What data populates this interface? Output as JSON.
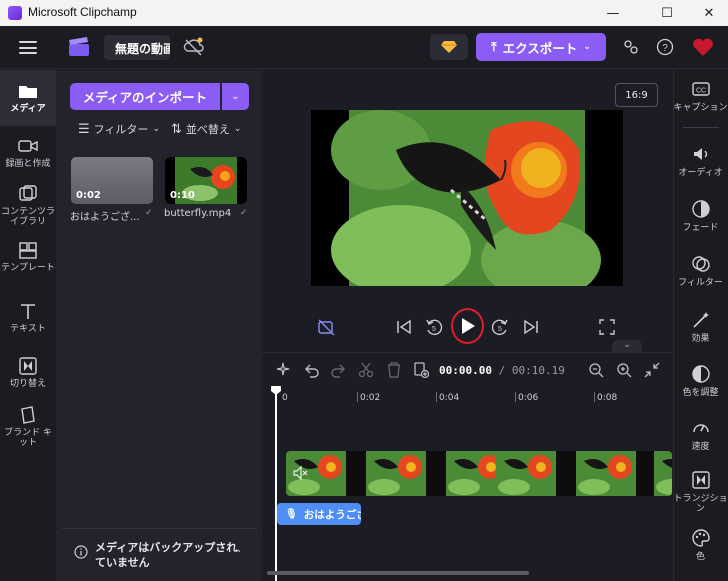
{
  "window": {
    "title": "Microsoft Clipchamp",
    "minimize": "—",
    "maximize": "☐",
    "close": "✕"
  },
  "header": {
    "project_title": "無題の動画",
    "export_label": "エクスポート"
  },
  "left_nav": [
    {
      "label": "メディア",
      "icon": "media-folder-icon"
    },
    {
      "label": "録画と作成",
      "icon": "camera-icon"
    },
    {
      "label": "コンテンツライブラリ",
      "icon": "library-icon"
    },
    {
      "label": "テンプレート",
      "icon": "template-icon"
    },
    {
      "label": "テキスト",
      "icon": "text-icon"
    },
    {
      "label": "切り替え",
      "icon": "transition-icon"
    },
    {
      "label": "ブランド キット",
      "icon": "brand-kit-icon"
    }
  ],
  "media": {
    "import_label": "メディアのインポート",
    "filter_label": "フィルター",
    "sort_label": "並べ替え",
    "items": [
      {
        "name": "おはようござ...",
        "duration": "0:02"
      },
      {
        "name": "butterfly.mp4",
        "duration": "0:10"
      }
    ],
    "backup_notice": "メディアはバックアップされていません"
  },
  "preview": {
    "aspect_ratio": "16:9"
  },
  "timeline": {
    "current_time": "00:00.00",
    "total_time": "/ 00:10.19",
    "ruler": [
      "0",
      "0:02",
      "0:04",
      "0:06",
      "0:08"
    ],
    "audio_clip_label": "おはようござ"
  },
  "right_bar": [
    {
      "label": "キャプション",
      "icon": "captions-icon"
    },
    {
      "label": "オーディオ",
      "icon": "audio-icon"
    },
    {
      "label": "フェード",
      "icon": "fade-icon"
    },
    {
      "label": "フィルター",
      "icon": "filter-icon"
    },
    {
      "label": "効果",
      "icon": "effects-icon"
    },
    {
      "label": "色を調整",
      "icon": "color-adjust-icon"
    },
    {
      "label": "速度",
      "icon": "speed-icon"
    },
    {
      "label": "トランジション",
      "icon": "transition-icon"
    },
    {
      "label": "色",
      "icon": "palette-icon"
    }
  ],
  "colors": {
    "accent": "#8b5cf6",
    "audio_clip": "#4f8ef7",
    "play_highlight": "#e11d2b"
  }
}
